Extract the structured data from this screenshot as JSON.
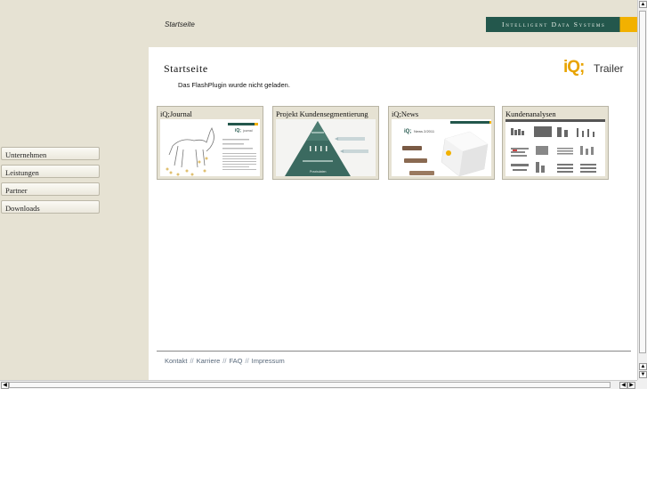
{
  "header": {
    "breadcrumb": "Startseite",
    "logo_text": "Intelligent Data Systems"
  },
  "main": {
    "title": "Startseite",
    "flash_message": "Das FlashPlugin wurde nicht geladen.",
    "trailer": {
      "brand": "iQ;",
      "label": "Trailer"
    },
    "cards": [
      {
        "label": "iQ;Journal"
      },
      {
        "label": "Projekt Kundensegmentierung"
      },
      {
        "label": "iQ;News"
      },
      {
        "label": "Kundenanalysen"
      }
    ],
    "thumb_text": {
      "journal_brand": "iQ;",
      "journal_sub": "journal",
      "news_brand": "iQ;",
      "news_sub": "News 2/2011",
      "pyramid_base": "Praxisdaten"
    }
  },
  "sidebar": {
    "items": [
      {
        "label": "Unternehmen"
      },
      {
        "label": "Leistungen"
      },
      {
        "label": "Partner"
      },
      {
        "label": "Downloads"
      }
    ]
  },
  "footer": {
    "links": [
      "Kontakt",
      "Karriere",
      "FAQ",
      "Impressum"
    ],
    "separator": "//"
  },
  "colors": {
    "background": "#e6e2d3",
    "logo_green": "#23574c",
    "accent_gold": "#f2b100",
    "footer_link": "#58687a"
  },
  "icons": {
    "scroll_up": "arrow-up-icon",
    "scroll_down": "arrow-down-icon",
    "scroll_left": "arrow-left-icon",
    "scroll_right": "arrow-right-icon"
  }
}
